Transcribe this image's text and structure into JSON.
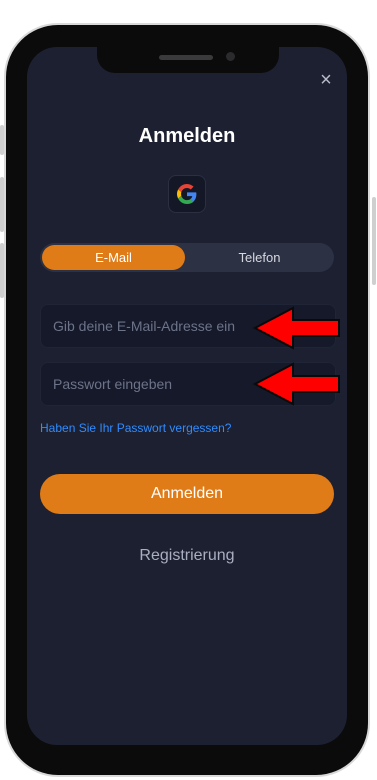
{
  "dialog": {
    "close_label": "×",
    "title": "Anmelden",
    "google_icon": "google-icon"
  },
  "tabs": {
    "email": "E-Mail",
    "phone": "Telefon",
    "active": "email"
  },
  "email": {
    "placeholder": "Gib deine E-Mail-Adresse ein",
    "value": ""
  },
  "password": {
    "placeholder": "Passwort eingeben",
    "value": ""
  },
  "forgot_password": "Haben Sie Ihr Passwort vergessen?",
  "login_button": "Anmelden",
  "register_link": "Registrierung",
  "colors": {
    "accent": "#e07c17",
    "background": "#1c2031",
    "link": "#2f8cff",
    "arrow": "#ff0000"
  }
}
